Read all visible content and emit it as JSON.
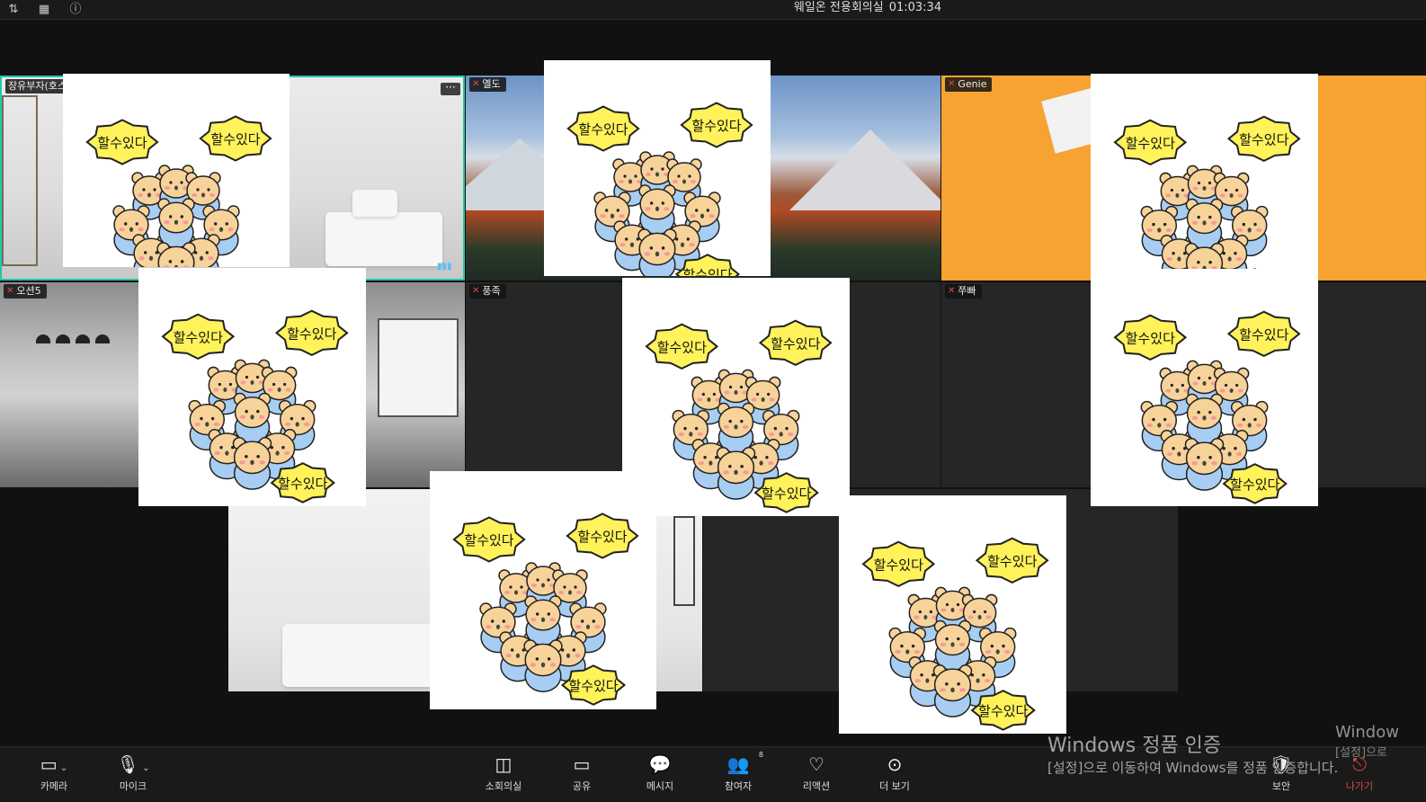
{
  "topbar": {
    "title": "웨일온 전용회의실",
    "timer": "01:03:34",
    "icons": [
      "sort-icon",
      "grid-icon",
      "info-icon"
    ]
  },
  "tiles": [
    {
      "name": "장유부자(호스",
      "muted": false
    },
    {
      "name": "옐도",
      "muted": true
    },
    {
      "name": "Genie",
      "muted": true
    },
    {
      "name": "오션5",
      "muted": true
    },
    {
      "name": "풍족",
      "muted": true
    },
    {
      "name": "쭈빠",
      "muted": true
    }
  ],
  "sticker": {
    "bubble_text": "할수있다"
  },
  "toolbar": {
    "camera": "카메라",
    "mic": "마이크",
    "breakout": "소회의실",
    "share": "공유",
    "message": "메시지",
    "participants": "참여자",
    "participants_count": "8",
    "reaction": "리액션",
    "more": "더 보기",
    "security": "보안",
    "leave": "나가기"
  },
  "watermark": {
    "title": "Windows 정품 인증",
    "subtitle": "[설정]으로 이동하여 Windows를 정품 인증합니다.",
    "edge_title": "Window",
    "edge_sub": "[설정]으로"
  },
  "colors": {
    "active_speaker_border": "#22c8a8",
    "muted": "#e0484b",
    "leave": "#e0484b"
  }
}
